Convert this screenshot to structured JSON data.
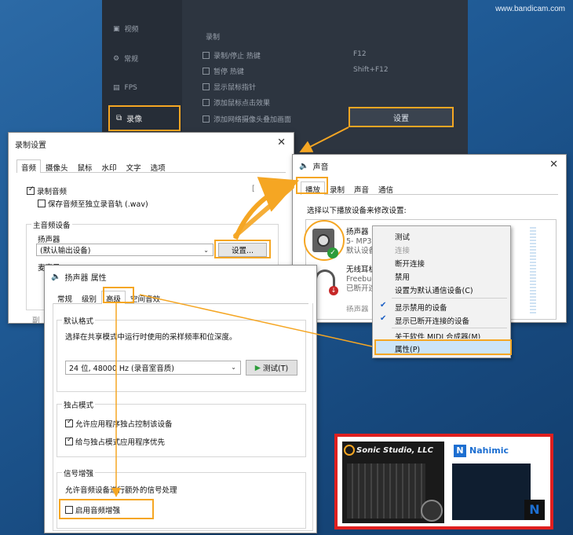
{
  "watermark": "www.bandicam.com",
  "bandicam": {
    "sidebar": [
      {
        "label": "视频",
        "icon": "video-icon"
      },
      {
        "label": "常规",
        "icon": "gear-icon"
      },
      {
        "label": "FPS",
        "icon": "fps-icon"
      },
      {
        "label": "录像",
        "icon": "record-icon"
      }
    ],
    "section_title": "录制",
    "options": [
      {
        "label": "录制/停止 热键",
        "checked": true
      },
      {
        "label": "暂停 热键",
        "checked": false
      },
      {
        "label": "显示鼠标指针",
        "checked": false
      },
      {
        "label": "添加鼠标点击效果",
        "checked": false
      },
      {
        "label": "添加网络摄像头叠加画面",
        "checked": false
      }
    ],
    "hotkey1": "F12",
    "hotkey2": "Shift+F12",
    "settings_button": "设置"
  },
  "record_settings": {
    "title": "录制设置",
    "tabs": [
      "音频",
      "摄像头",
      "鼠标",
      "水印",
      "文字",
      "选项"
    ],
    "record_audio": "录制音频",
    "save_separate": "保存音频至独立录音轨 (.wav)",
    "primary_device_group": "主音频设备",
    "speaker_label": "扬声器",
    "speaker_value": "(默认输出设备)",
    "settings_button": "设置...",
    "mic_label": "麦克风",
    "side_label": "副",
    "bracket_label": "[ "
  },
  "sound": {
    "title": "声音",
    "tabs": [
      "播放",
      "录制",
      "声音",
      "通信"
    ],
    "instruction": "选择以下播放设备来修改设置:",
    "devices": [
      {
        "name": "扬声器",
        "sub1": "5- MP30",
        "sub2": "默认设备"
      },
      {
        "name": "无线耳机",
        "sub1": "Freebud",
        "sub2": "已断开连接"
      }
    ],
    "partial_label": "扬声器"
  },
  "context_menu": {
    "items": [
      "测试",
      "连接",
      "断开连接",
      "禁用",
      "设置为默认通信设备(C)",
      "显示禁用的设备",
      "显示已断开连接的设备",
      "关于软件 MIDI 合成器(M)",
      "属性(P)"
    ]
  },
  "speaker_props": {
    "title": "扬声器 属性",
    "tabs": [
      "常规",
      "级别",
      "高级",
      "空间音效"
    ],
    "default_format_group": "默认格式",
    "default_format_desc": "选择在共享模式中运行时使用的采样频率和位深度。",
    "format_value": "24 位, 48000 Hz (录音室音质)",
    "test_button": "测试(T)",
    "exclusive_group": "独占模式",
    "exclusive_opt1": "允许应用程序独占控制该设备",
    "exclusive_opt2": "给与独占模式应用程序优先",
    "enhance_group": "信号增强",
    "enhance_desc": "允许音频设备进行额外的信号处理",
    "enhance_opt": "启用音频增强"
  },
  "promo": {
    "left_brand": "Sonic Studio, LLC",
    "right_brand": "Nahimic"
  },
  "colors": {
    "highlight": "#f5a623",
    "promo_border": "#e01f1f",
    "accent": "#1b5fc4"
  }
}
